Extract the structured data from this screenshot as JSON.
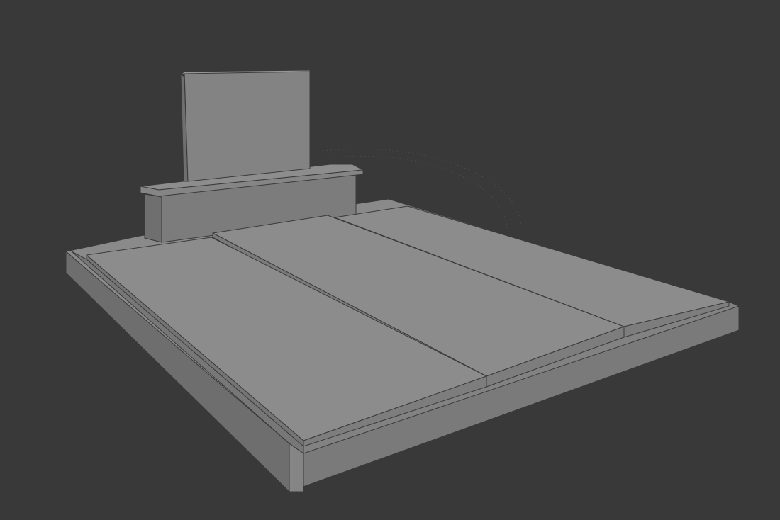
{
  "viewport": {
    "background_color": "#393939",
    "shading": "solid"
  },
  "model": {
    "object": "grave monument",
    "material_color": "#8a8a8a",
    "parts": [
      "base-frame",
      "headstone-pedestal",
      "headstone-slab",
      "cover-slab-left",
      "cover-slab-middle",
      "cover-slab-right"
    ]
  }
}
